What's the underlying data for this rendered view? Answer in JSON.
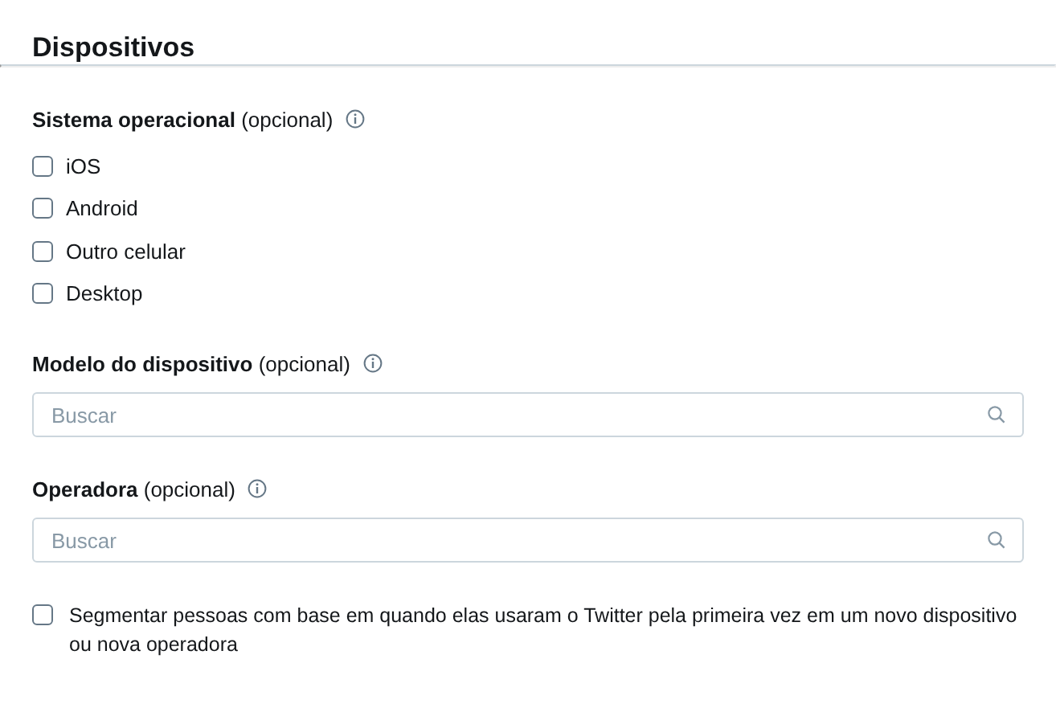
{
  "title": "Dispositivos",
  "os_section": {
    "label": "**Sistema operacional** (opcional)",
    "options": [
      {
        "label": "iOS",
        "checked": false
      },
      {
        "label": "Android",
        "checked": false
      },
      {
        "label": "Outro celular",
        "checked": false
      },
      {
        "label": "Desktop",
        "checked": false
      }
    ]
  },
  "device_model": {
    "label": "**Modelo do dispositivo** (opcional)",
    "search": {
      "placeholder": "Buscar"
    }
  },
  "carrier": {
    "label": "**Operadora** (opcional)",
    "search": {
      "placeholder": "Buscar"
    }
  },
  "first_use": {
    "label": "Segmentar pessoas com base em quando elas usaram o Twitter pela primeira vez em um novo dispositivo ou nova operadora",
    "checked": false
  }
}
